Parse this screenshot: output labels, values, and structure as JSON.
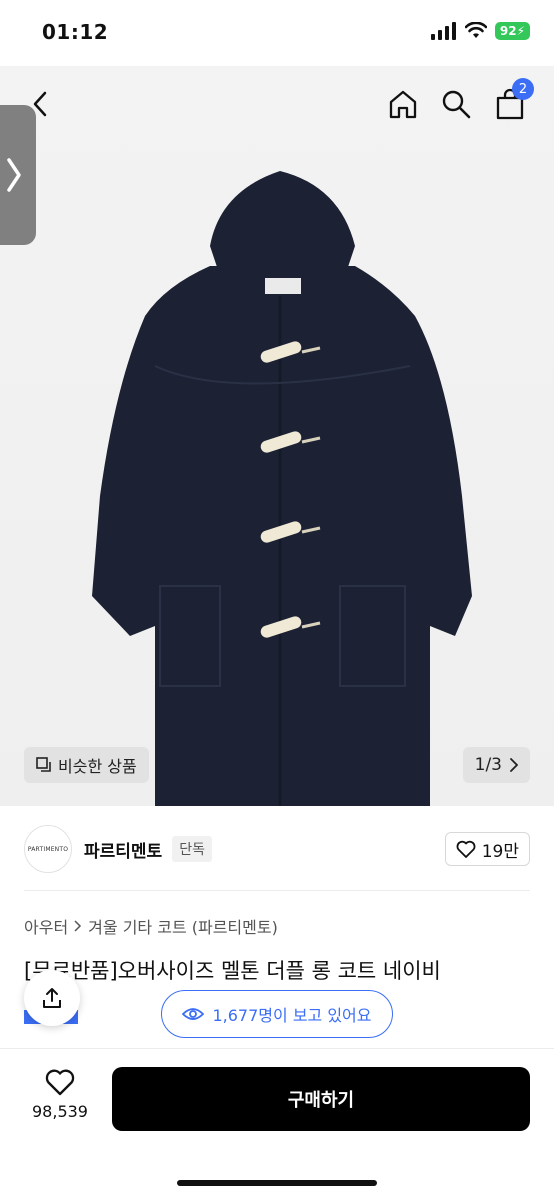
{
  "status_bar": {
    "time": "01:12",
    "battery": "92"
  },
  "hero": {
    "similar_label": "비슷한 상품",
    "page_indicator": "1/3"
  },
  "brand": {
    "logo_text": "PARTIMENTO",
    "name": "파르티멘토",
    "tag": "단독",
    "likes": "19만"
  },
  "cart": {
    "badge": "2"
  },
  "breadcrumb": {
    "level1": "아우터",
    "level2": "겨울 기타 코트 (파르티멘토)"
  },
  "product": {
    "title": "[무료반품]오버사이즈 멜톤 더플 롱 코트 네이비",
    "viewers": "1,677명이 보고 있어요"
  },
  "bottom": {
    "wish_count": "98,539",
    "buy_label": "구매하기"
  },
  "colors": {
    "accent": "#3b6ef5",
    "coat": "#1c2233",
    "toggle": "#efe9d6"
  }
}
